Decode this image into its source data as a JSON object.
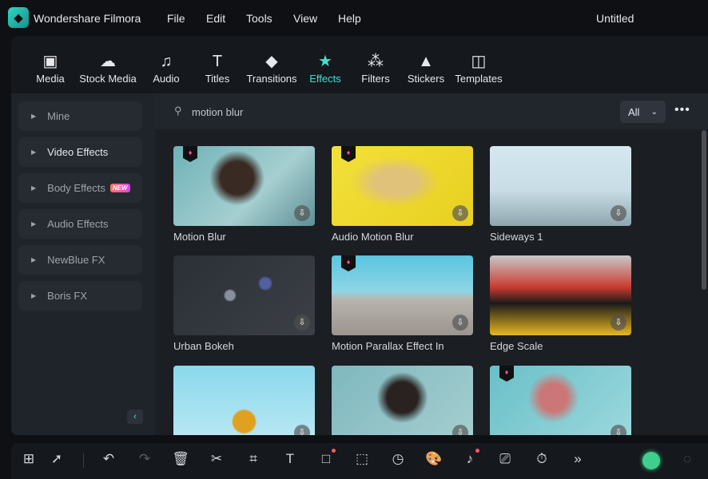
{
  "titlebar": {
    "app_name": "Wondershare Filmora",
    "menus": [
      "File",
      "Edit",
      "Tools",
      "View",
      "Help"
    ],
    "document_title": "Untitled"
  },
  "tabs": [
    {
      "label": "Media",
      "icon": "image-icon"
    },
    {
      "label": "Stock Media",
      "icon": "cloud-icon"
    },
    {
      "label": "Audio",
      "icon": "music-note-icon"
    },
    {
      "label": "Titles",
      "icon": "text-icon"
    },
    {
      "label": "Transitions",
      "icon": "transition-icon"
    },
    {
      "label": "Effects",
      "icon": "sparkle-star-icon",
      "active": true
    },
    {
      "label": "Filters",
      "icon": "filters-icon"
    },
    {
      "label": "Stickers",
      "icon": "sticker-icon"
    },
    {
      "label": "Templates",
      "icon": "template-icon"
    }
  ],
  "sidebar": {
    "items": [
      {
        "label": "Mine"
      },
      {
        "label": "Video Effects",
        "selected": true
      },
      {
        "label": "Body Effects",
        "badge": "NEW"
      },
      {
        "label": "Audio Effects"
      },
      {
        "label": "NewBlue FX"
      },
      {
        "label": "Boris FX"
      }
    ]
  },
  "search": {
    "value": "motion blur",
    "filter": "All"
  },
  "effects": [
    {
      "name": "Motion Blur",
      "premium": true
    },
    {
      "name": "Audio Motion Blur",
      "premium": true
    },
    {
      "name": "Sideways 1",
      "premium": false
    },
    {
      "name": "Urban Bokeh",
      "premium": false
    },
    {
      "name": "Motion Parallax Effect In",
      "premium": true
    },
    {
      "name": "Edge Scale",
      "premium": false
    },
    {
      "name": "",
      "premium": false
    },
    {
      "name": "",
      "premium": false
    },
    {
      "name": "",
      "premium": true
    }
  ],
  "colors": {
    "accent": "#3fe0d0",
    "premium": "#ff4fa8",
    "background": "#1b1e23"
  }
}
